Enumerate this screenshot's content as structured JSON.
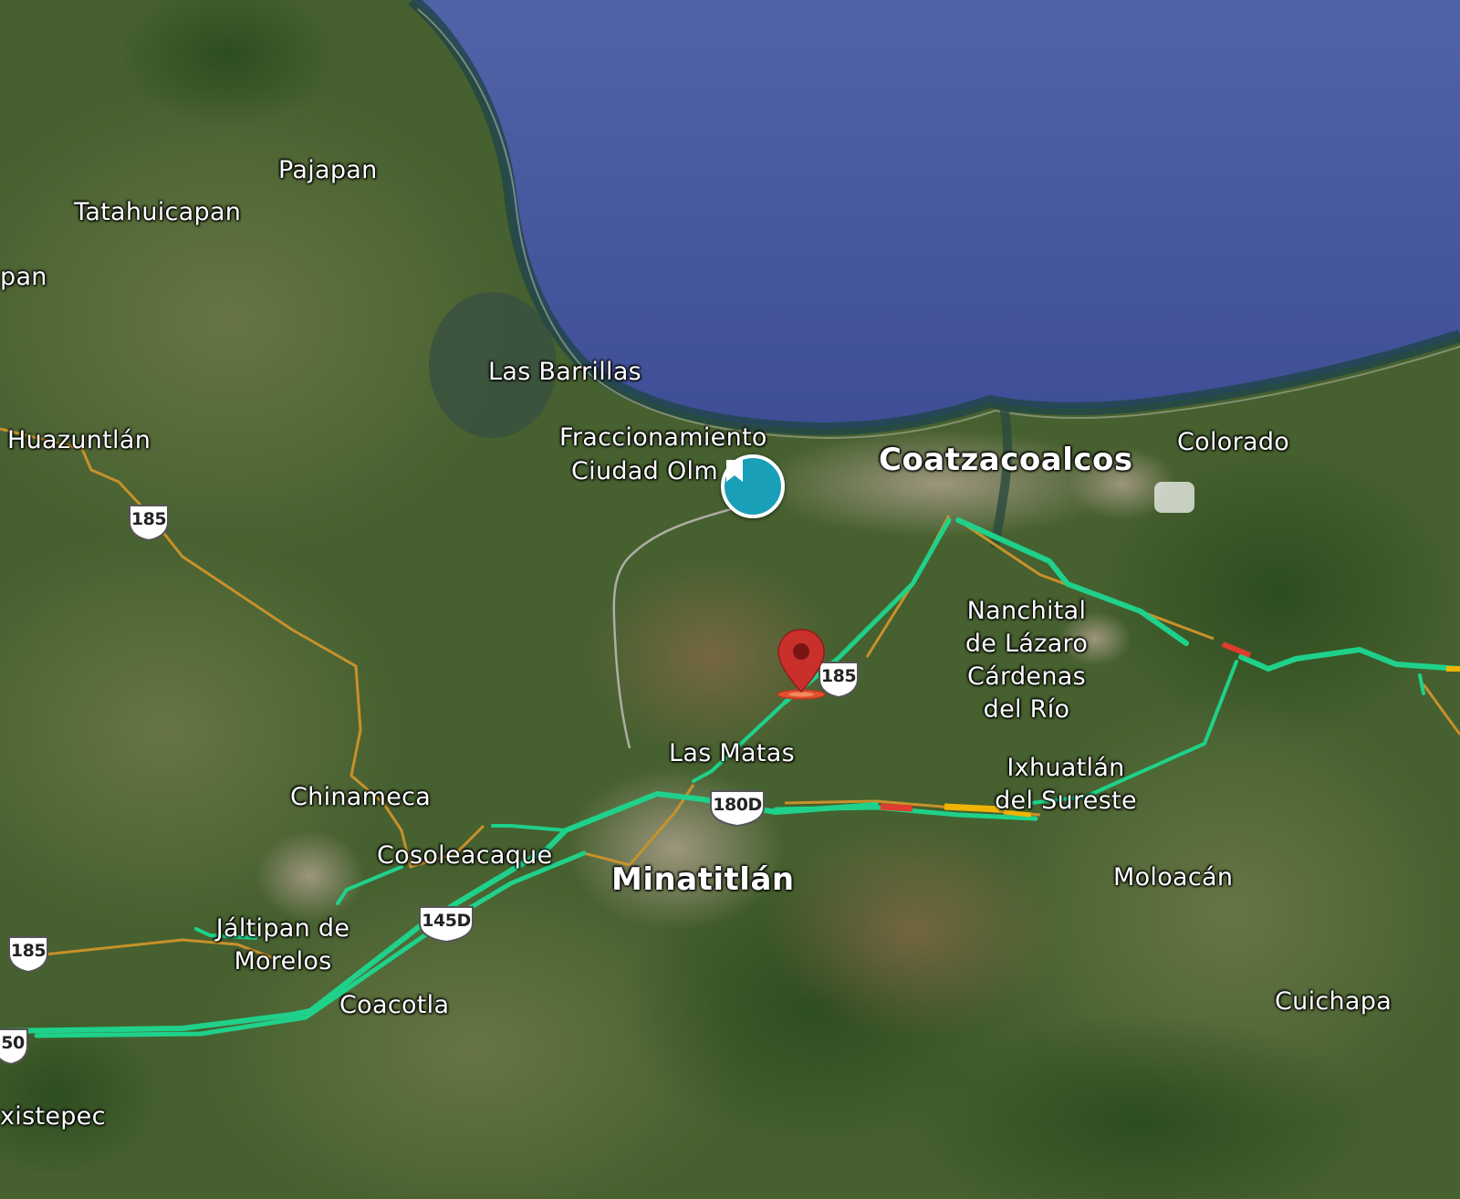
{
  "map": {
    "view": "satellite",
    "traffic_colors": {
      "free": "#1fd18a",
      "slow": "#f0b400",
      "heavy": "#e03b2e",
      "road": "#c8912a"
    }
  },
  "places": {
    "pajapan": "Pajapan",
    "tatahuicapan": "Tatahuicapan",
    "pan": "pan",
    "las_barrillas": "Las Barrillas",
    "huazuntlan": "Huazuntlán",
    "fraccionamiento_1": "Fraccionamiento",
    "fraccionamiento_2": "Ciudad Olm",
    "coatzacoalcos": "Coatzacoalcos",
    "colorado": "Colorado",
    "nanchital_1": "Nanchital",
    "nanchital_2": "de Lázaro",
    "nanchital_3": "Cárdenas",
    "nanchital_4": "del Río",
    "las_matas": "Las Matas",
    "ixhuatlan_1": "Ixhuatlán",
    "ixhuatlan_2": "del Sureste",
    "chinameca": "Chinameca",
    "cosoleacaque": "Cosoleacaque",
    "minatitlan": "Minatitlán",
    "moloacan": "Moloacán",
    "jaltipan_1": "Jáltipan de",
    "jaltipan_2": "Morelos",
    "coacotla": "Coacotla",
    "cuichapa": "Cuichapa",
    "xistepec": "xistepec"
  },
  "shields": {
    "s185_west": "185",
    "s185_center": "185",
    "s185_southwest": "185",
    "s180d": "180D",
    "s145d": "145D",
    "s150_edge": "50"
  },
  "markers": {
    "saved_place": "bookmark-icon",
    "dropped_pin": "map-pin-icon"
  }
}
